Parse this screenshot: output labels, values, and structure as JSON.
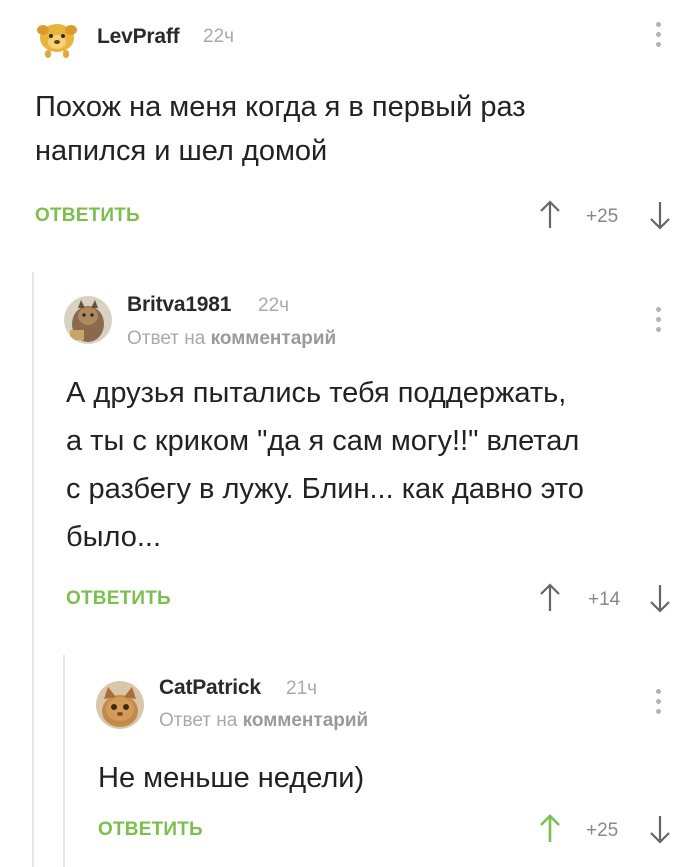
{
  "comments": [
    {
      "author": "LevPraff",
      "time": "22ч",
      "text_lines": [
        "Похож на меня когда я в первый раз",
        "напился и шел домой"
      ],
      "reply_label": "ОТВЕТИТЬ",
      "score": "+25",
      "avatar_icon": "lion-cub-avatar"
    },
    {
      "author": "Britva1981",
      "time": "22ч",
      "reply_prefix": "Ответ на",
      "reply_target": "комментарий",
      "text_lines": [
        "А друзья пытались тебя поддержать,",
        "а ты с криком \"да я сам могу!!\" влетал",
        "с разбегу в лужу. Блин... как давно это",
        "было..."
      ],
      "reply_label": "ОТВЕТИТЬ",
      "score": "+14",
      "avatar_icon": "cat-photo-avatar"
    },
    {
      "author": "CatPatrick",
      "time": "21ч",
      "reply_prefix": "Ответ на",
      "reply_target": "комментарий",
      "text_lines": [
        "Не меньше недели)"
      ],
      "reply_label": "ОТВЕТИТЬ",
      "score": "+25",
      "upvoted": true,
      "avatar_icon": "kitten-photo-avatar"
    }
  ],
  "colors": {
    "accent_green": "#7cbf4e",
    "muted_gray": "#a9a9a9",
    "text": "#222222"
  }
}
